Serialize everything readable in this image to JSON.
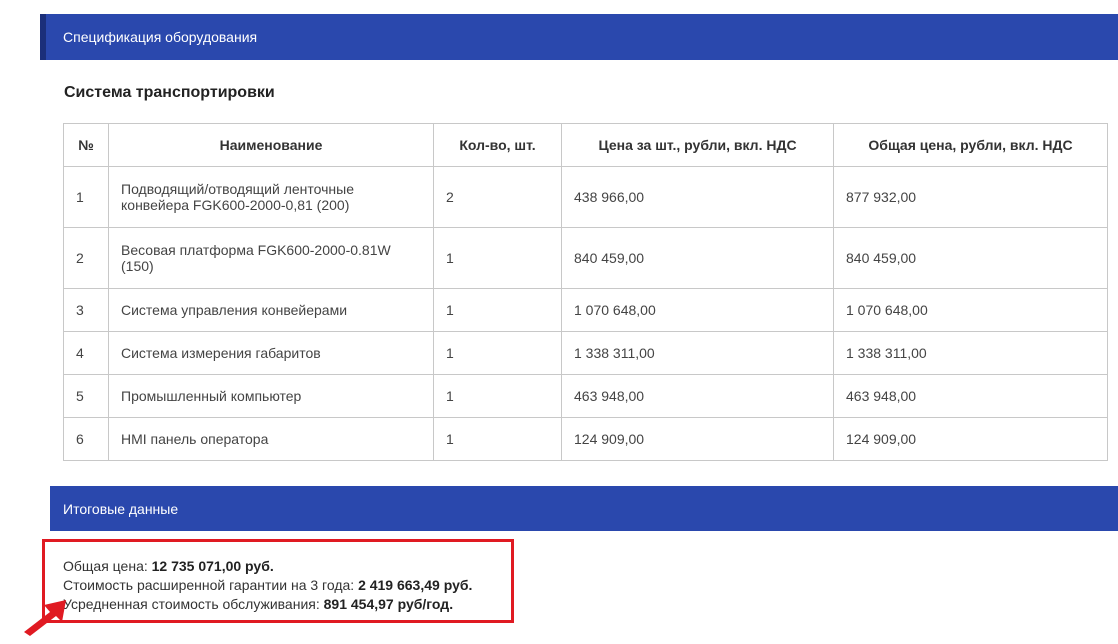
{
  "header": {
    "title": "Спецификация оборудования"
  },
  "section": {
    "title": "Система транспортировки"
  },
  "table": {
    "columns": [
      "№",
      "Наименование",
      "Кол-во, шт.",
      "Цена за шт., рубли, вкл. НДС",
      "Общая цена, рубли, вкл. НДС"
    ],
    "rows": [
      [
        "1",
        "Подводящий/отводящий ленточные конвейера FGK600-2000-0,81 (200)",
        "2",
        "438 966,00",
        "877 932,00"
      ],
      [
        "2",
        "Весовая платформа FGK600-2000-0.81W (150)",
        "1",
        "840 459,00",
        "840 459,00"
      ],
      [
        "3",
        "Система управления конвейерами",
        "1",
        "1 070 648,00",
        "1 070 648,00"
      ],
      [
        "4",
        "Система измерения габаритов",
        "1",
        "1 338 311,00",
        "1 338 311,00"
      ],
      [
        "5",
        "Промышленный компьютер",
        "1",
        "463 948,00",
        "463 948,00"
      ],
      [
        "6",
        "HMI панель оператора",
        "1",
        "124 909,00",
        "124 909,00"
      ]
    ]
  },
  "summary": {
    "title": "Итоговые данные",
    "lines": [
      {
        "label": "Общая цена: ",
        "value": "12 735 071,00 руб."
      },
      {
        "label": "Стоимость расширенной гарантии на 3 года: ",
        "value": "2 419 663,49 руб."
      },
      {
        "label": "Усредненная стоимость обслуживания: ",
        "value": "891 454,97 руб/год."
      }
    ]
  },
  "colors": {
    "header_bg": "#2a48ad",
    "highlight": "#e01a22"
  },
  "icons": {
    "pointer": "red-arrow-icon"
  }
}
